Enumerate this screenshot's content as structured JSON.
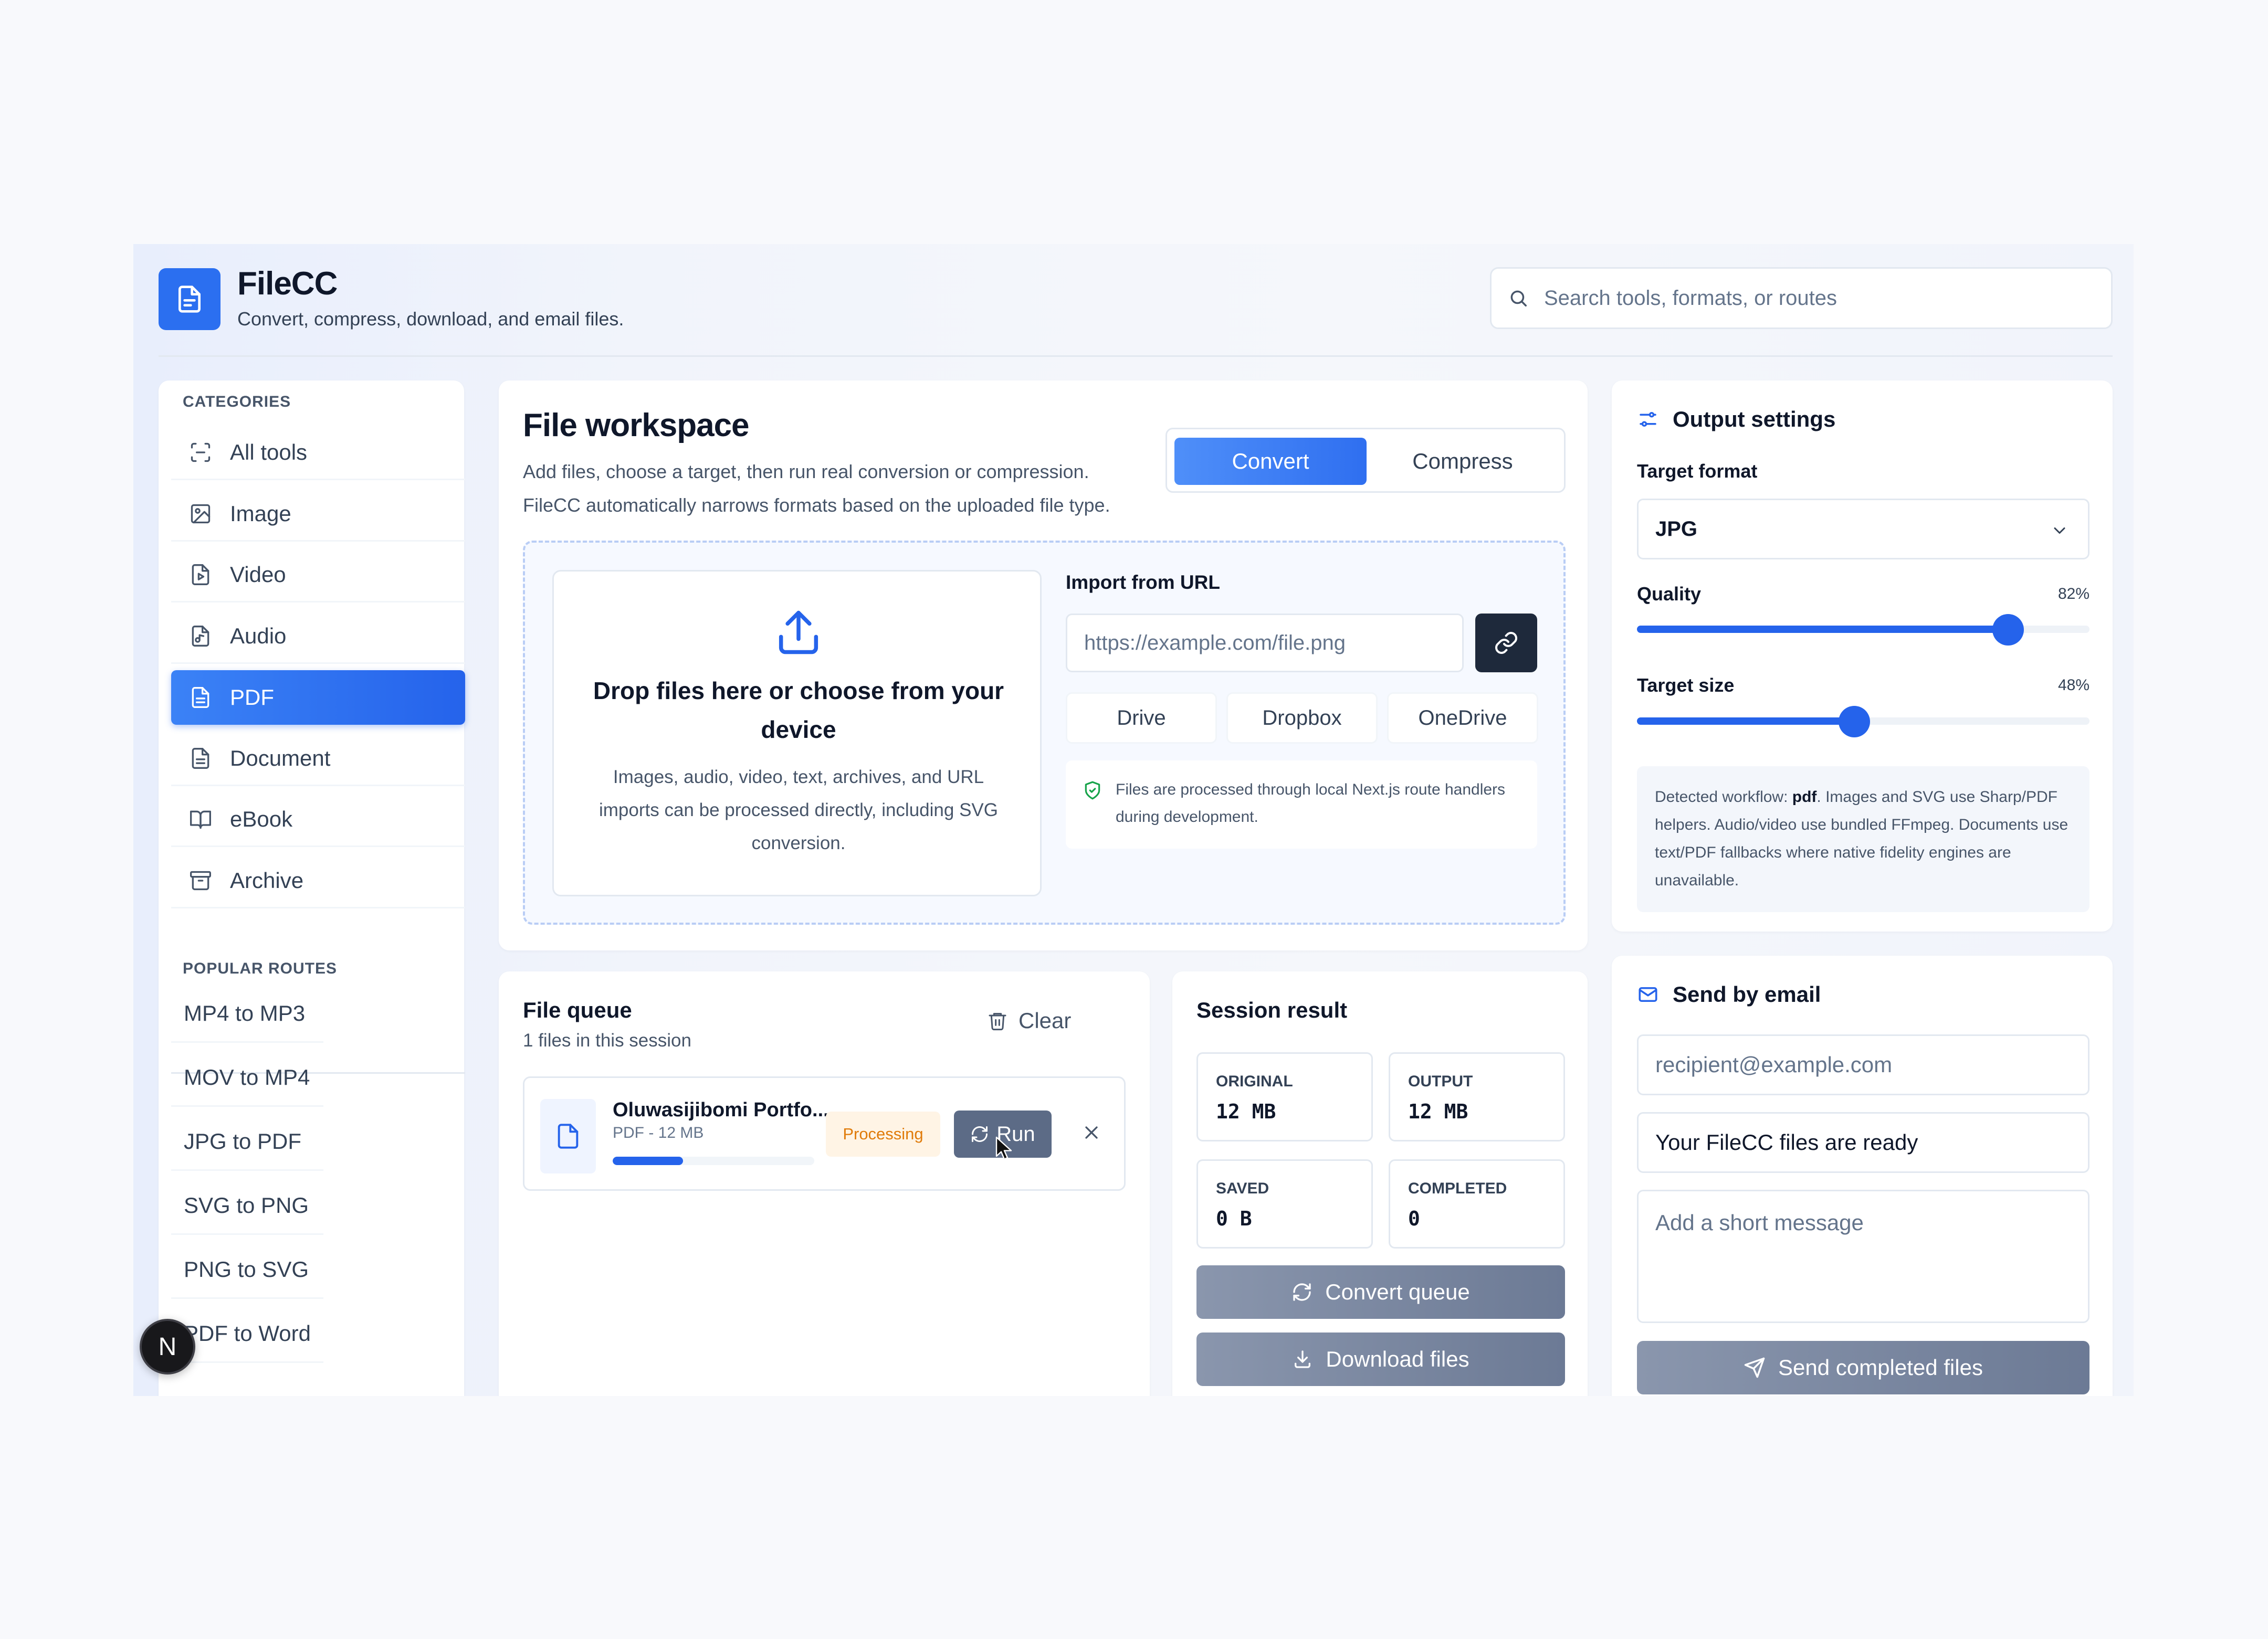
{
  "app": {
    "name": "FileCC",
    "tagline": "Convert, compress, download, and email files."
  },
  "search": {
    "placeholder": "Search tools, formats, or routes"
  },
  "sidebar": {
    "categories_label": "CATEGORIES",
    "items": [
      {
        "label": "All tools",
        "icon": "scan-icon"
      },
      {
        "label": "Image",
        "icon": "image-icon"
      },
      {
        "label": "Video",
        "icon": "file-video-icon"
      },
      {
        "label": "Audio",
        "icon": "file-audio-icon"
      },
      {
        "label": "PDF",
        "icon": "file-text-icon",
        "active": true
      },
      {
        "label": "Document",
        "icon": "file-doc-icon"
      },
      {
        "label": "eBook",
        "icon": "book-icon"
      },
      {
        "label": "Archive",
        "icon": "archive-icon"
      }
    ],
    "routes_label": "POPULAR ROUTES",
    "routes": [
      "MP4 to MP3",
      "MOV to MP4",
      "JPG to PDF",
      "SVG to PNG",
      "PNG to SVG",
      "PDF to Word"
    ]
  },
  "workspace": {
    "title": "File workspace",
    "desc_line1": "Add files, choose a target, then run real conversion or compression.",
    "desc_line2": "FileCC automatically narrows formats based on the uploaded file type.",
    "mode_convert": "Convert",
    "mode_compress": "Compress",
    "active_mode": "Convert",
    "drop_title": "Drop files here or choose from your device",
    "drop_desc": "Images, audio, video, text, archives, and URL imports can be processed directly, including SVG conversion.",
    "url_label": "Import from URL",
    "url_placeholder": "https://example.com/file.png",
    "cloud": [
      "Drive",
      "Dropbox",
      "OneDrive"
    ],
    "note": "Files are processed through local Next.js route handlers during development."
  },
  "queue": {
    "title": "File queue",
    "count_text": "1 files in this session",
    "clear_label": "Clear",
    "files": [
      {
        "name": "Oluwasijibomi Portfo...",
        "meta": "PDF - 12 MB",
        "status": "Processing",
        "progress": 0.35,
        "run_label": "Run"
      }
    ]
  },
  "session": {
    "title": "Session result",
    "stats": [
      {
        "label": "ORIGINAL",
        "value": "12 MB"
      },
      {
        "label": "OUTPUT",
        "value": "12 MB"
      },
      {
        "label": "SAVED",
        "value": "0 B"
      },
      {
        "label": "COMPLETED",
        "value": "0"
      }
    ],
    "convert_label": "Convert queue",
    "download_label": "Download files"
  },
  "output": {
    "title": "Output settings",
    "format_label": "Target format",
    "format_value": "JPG",
    "quality_label": "Quality",
    "quality_text": "82%",
    "quality_value": 82,
    "size_label": "Target size",
    "size_text": "48%",
    "size_value": 48,
    "note_prefix": "Detected workflow: ",
    "note_workflow": "pdf",
    "note_rest": ". Images and SVG use Sharp/PDF helpers. Audio/video use bundled FFmpeg. Documents use text/PDF fallbacks where native fidelity engines are unavailable."
  },
  "email": {
    "title": "Send by email",
    "recipient_placeholder": "recipient@example.com",
    "subject_value": "Your FileCC files are ready",
    "message_placeholder": "Add a short message",
    "send_label": "Send completed files"
  },
  "fab_label": "N",
  "colors": {
    "accent": "#2563eb",
    "badge_text": "#e07b0a",
    "badge_bg": "#fff4e5",
    "dark_button": "#1e293b"
  }
}
